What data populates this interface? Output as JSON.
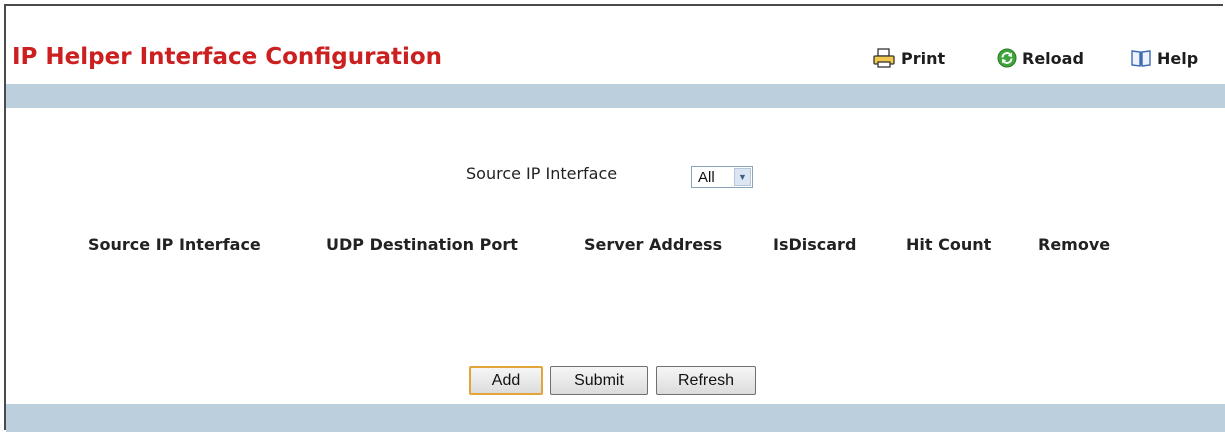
{
  "page": {
    "title": "IP Helper Interface Configuration"
  },
  "toolbar": {
    "print": "Print",
    "reload": "Reload",
    "help": "Help"
  },
  "filter": {
    "label": "Source IP Interface",
    "selected": "All"
  },
  "table": {
    "headers": [
      "Source IP Interface",
      "UDP Destination Port",
      "Server Address",
      "IsDiscard",
      "Hit Count",
      "Remove"
    ],
    "rows": []
  },
  "buttons": {
    "add": "Add",
    "submit": "Submit",
    "refresh": "Refresh"
  },
  "colors": {
    "title": "#cc1f1f",
    "band": "#bccfdc",
    "default_button_border": "#e3a53a"
  },
  "icons": {
    "print": "printer-icon",
    "reload": "reload-icon",
    "help": "help-book-icon"
  }
}
